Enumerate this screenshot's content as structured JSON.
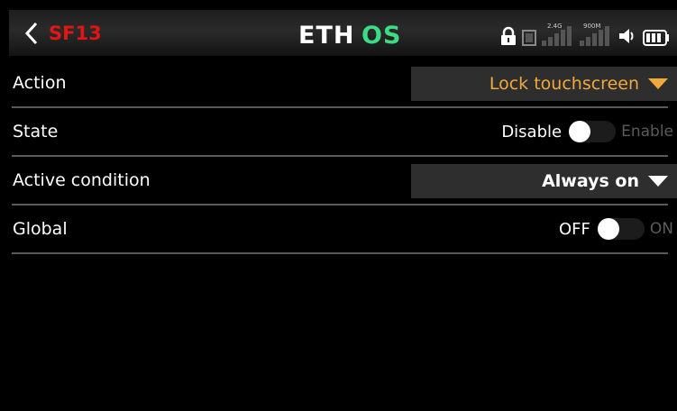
{
  "header": {
    "title": "SF13",
    "logo_text": "ETHOS",
    "signal_24_label": "2.4G",
    "signal_900_label": "900M"
  },
  "rows": [
    {
      "label": "Action",
      "value": "Lock touchscreen"
    },
    {
      "label": "State",
      "off_label": "Disable",
      "on_label": "Enable"
    },
    {
      "label": "Active condition",
      "value": "Always on"
    },
    {
      "label": "Global",
      "off_label": "OFF",
      "on_label": "ON"
    }
  ],
  "colors": {
    "accent_orange": "#f2a93c",
    "title_red": "#e01515",
    "logo_green": "#3ddc84",
    "divider": "#5a5a5a"
  },
  "icons": {
    "back": "chevron-left-icon",
    "lock": "lock-icon",
    "signal": "signal-bars-icon",
    "audio": "speaker-icon",
    "battery": "battery-icon"
  }
}
